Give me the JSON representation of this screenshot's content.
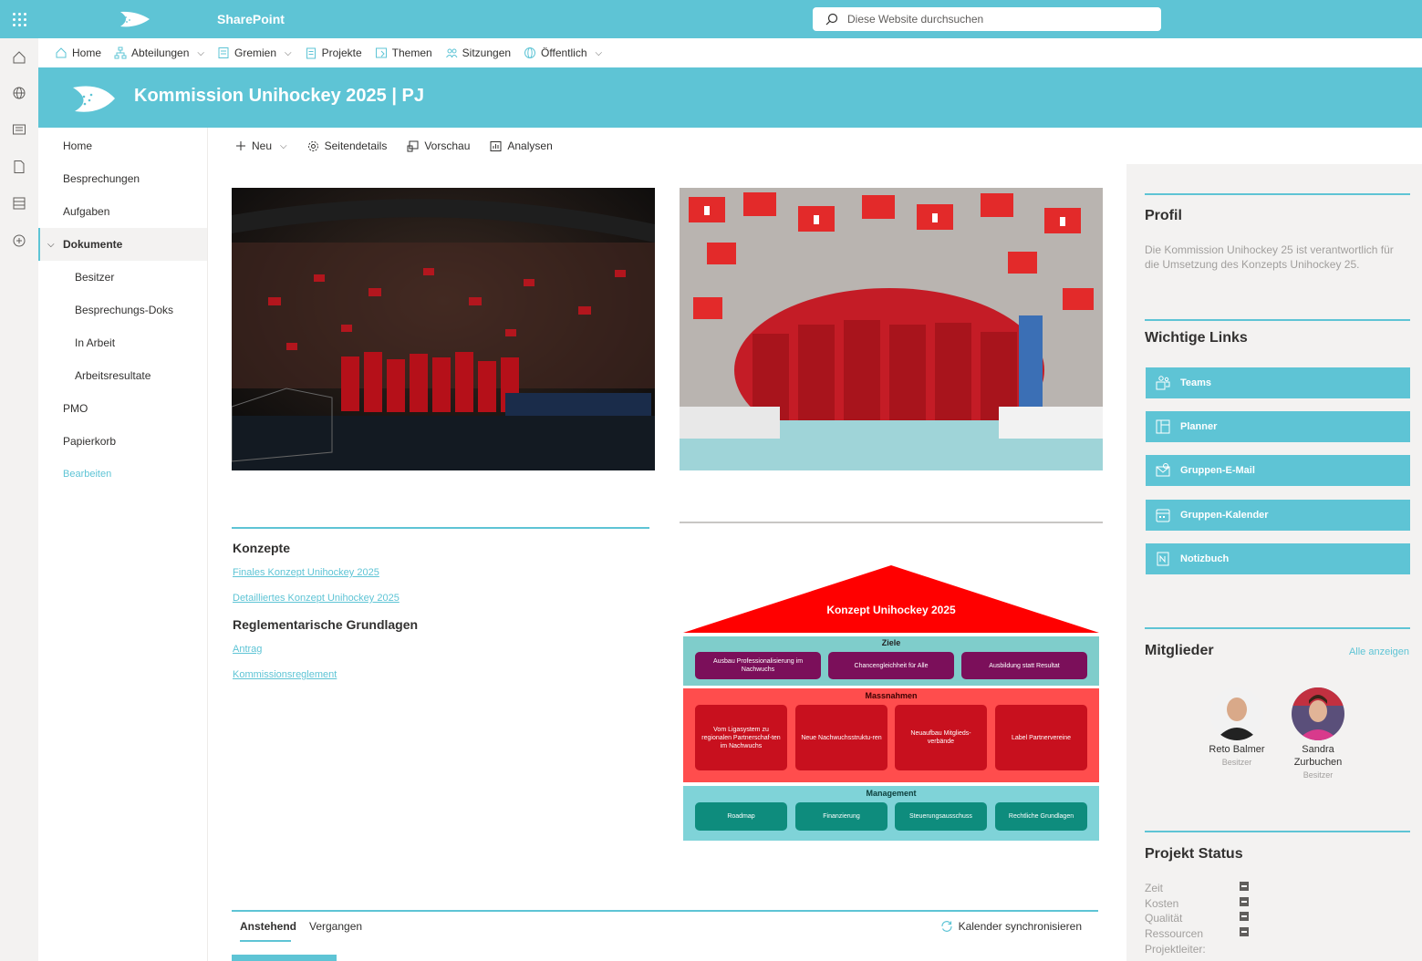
{
  "suitebar": {
    "app_title": "SharePoint",
    "logo_text": "swiss unihockey",
    "search_placeholder": "Diese Website durchsuchen"
  },
  "topnav": {
    "items": [
      {
        "label": "Home",
        "icon": "home-icon"
      },
      {
        "label": "Abteilungen",
        "icon": "org-icon",
        "has_dropdown": true
      },
      {
        "label": "Gremien",
        "icon": "list-icon",
        "has_dropdown": true
      },
      {
        "label": "Projekte",
        "icon": "clipboard-icon"
      },
      {
        "label": "Themen",
        "icon": "document-icon"
      },
      {
        "label": "Sitzungen",
        "icon": "people-icon"
      },
      {
        "label": "Öffentlich",
        "icon": "globe-icon",
        "has_dropdown": true
      }
    ]
  },
  "site": {
    "title": "Kommission Unihockey 2025 | PJ"
  },
  "leftnav": {
    "items": [
      "Home",
      "Besprechungen",
      "Aufgaben",
      "Dokumente",
      "Besitzer",
      "Besprechungs-Doks",
      "In Arbeit",
      "Arbeitsresultate",
      "PMO",
      "Papierkorb"
    ],
    "edit_label": "Bearbeiten"
  },
  "commandbar": {
    "new_label": "Neu",
    "details_label": "Seitendetails",
    "preview_label": "Vorschau",
    "analytics_label": "Analysen"
  },
  "konzepte": {
    "title": "Konzepte",
    "links": [
      "Finales Konzept Unihockey 2025",
      "Detailliertes Konzept Unihockey 2025"
    ],
    "title2": "Reglementarische Grundlagen",
    "links2": [
      "Antrag",
      "Kommissionsreglement"
    ]
  },
  "diagram": {
    "roof_title": "Konzept Unihockey 2025",
    "ziele_title": "Ziele",
    "ziele": [
      "Ausbau Professionalisierung im Nachwuchs",
      "Chancengleichheit für Alle",
      "Ausbildung statt Resultat"
    ],
    "massnahmen_title": "Massnahmen",
    "massnahmen": [
      "Vom Ligasystem zu regionalen Partnerschaf-ten im Nachwuchs",
      "Neue Nachwuchsstruktu-ren",
      "Neuaufbau Mitglieds-verbände",
      "Label Partnervereine"
    ],
    "management_title": "Management",
    "management": [
      "Roadmap",
      "Finanzierung",
      "Steuerungsausschuss",
      "Rechtliche Grundlagen"
    ],
    "colors": {
      "roof": "#ff0000",
      "ziele_band": "#7fcdcb",
      "ziele_box": "#7b0f5a",
      "massnahmen_band": "#ff4d4d",
      "massnahmen_box": "#c8101e",
      "management_band": "#7fd3d8",
      "management_box": "#0e8c7d"
    }
  },
  "events": {
    "tab_upcoming": "Anstehend",
    "tab_past": "Vergangen",
    "sync_label": "Kalender synchronisieren"
  },
  "profil": {
    "title": "Profil",
    "text": "Die Kommission Unihockey 25 ist verantwortlich für die Umsetzung des Konzepts Unihockey 25."
  },
  "links": {
    "title": "Wichtige Links",
    "items": [
      {
        "label": "Teams",
        "icon": "teams-icon"
      },
      {
        "label": "Planner",
        "icon": "planner-icon"
      },
      {
        "label": "Gruppen-E-Mail",
        "icon": "mail-icon"
      },
      {
        "label": "Gruppen-Kalender",
        "icon": "calendar-icon"
      },
      {
        "label": "Notizbuch",
        "icon": "notebook-icon"
      }
    ]
  },
  "members": {
    "title": "Mitglieder",
    "show_all": "Alle anzeigen",
    "people": [
      {
        "name": "Reto Balmer",
        "role": "Besitzer"
      },
      {
        "name": "Sandra Zurbuchen",
        "role": "Besitzer"
      }
    ]
  },
  "status": {
    "title": "Projekt Status",
    "rows": [
      "Zeit",
      "Kosten",
      "Qualität",
      "Ressourcen",
      "Projektleiter:"
    ]
  },
  "theme": {
    "accent": "#5ec4d5"
  }
}
